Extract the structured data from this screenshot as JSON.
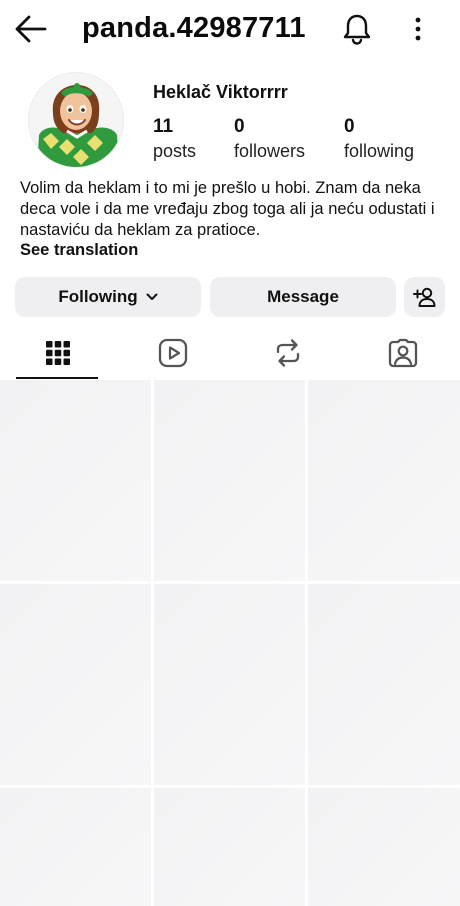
{
  "header": {
    "username": "panda.42987711",
    "back_icon": "arrow-left-icon",
    "notifications_icon": "bell-icon",
    "more_icon": "more-vertical-icon"
  },
  "profile": {
    "display_name": "Heklač Viktorrrr",
    "stats": [
      {
        "value": "11",
        "label": "posts"
      },
      {
        "value": "0",
        "label": "followers"
      },
      {
        "value": "0",
        "label": "following"
      }
    ],
    "bio": "Volim da heklam i to mi je prešlo u hobi. Znam da neka deca vole i da me vređaju zbog toga ali ja neću odustati i nastaviću da heklam za pratioce.",
    "see_translation": "See translation"
  },
  "actions": {
    "following_label": "Following",
    "message_label": "Message",
    "add_user_icon": "add-person-icon"
  },
  "tabs": [
    {
      "icon": "grid-icon",
      "active": true
    },
    {
      "icon": "reels-icon",
      "active": false
    },
    {
      "icon": "reposts-icon",
      "active": false
    },
    {
      "icon": "tagged-icon",
      "active": false
    }
  ],
  "colors": {
    "button_bg": "#efeff1",
    "text": "#111111",
    "placeholder": "#f3f3f5"
  }
}
